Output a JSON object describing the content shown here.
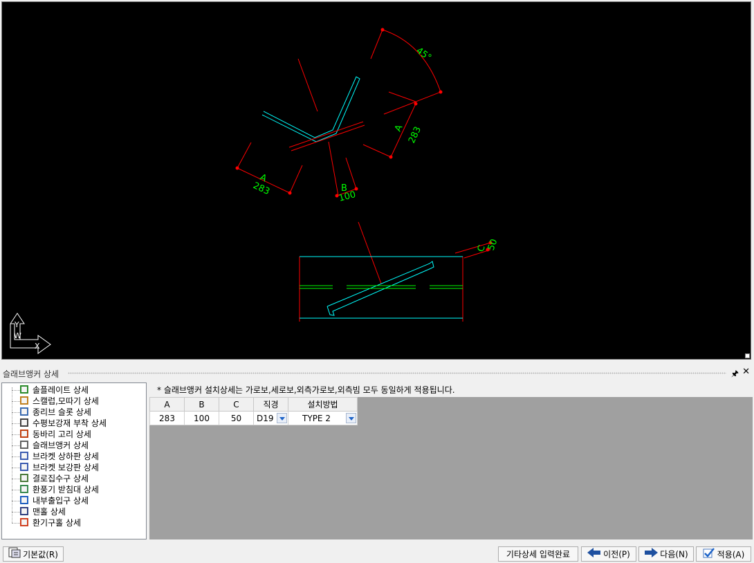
{
  "canvas": {
    "dims": {
      "angle": "45°",
      "dim_a_right": "A",
      "dim_a_right_value": "283",
      "dim_a_left": "A",
      "dim_a_left_value": "283",
      "dim_b": "B",
      "dim_b_value": "100",
      "dim_c": "C",
      "dim_c_value": "50"
    },
    "ucs": {
      "x": "X",
      "y": "Y",
      "w": "W"
    },
    "colors": {
      "background": "#000000",
      "shape": "#00ffff",
      "dimension": "#ff0000",
      "text": "#00ff00"
    }
  },
  "panel": {
    "title": "슬래브앵커 상세",
    "pin_icon": "pin-icon",
    "close_icon": "close-icon"
  },
  "tree": {
    "items": [
      {
        "label": "솔플레이트 상세",
        "icon": "sole-plate-icon"
      },
      {
        "label": "스캘럽,모따기 상세",
        "icon": "scallop-icon"
      },
      {
        "label": "종리브 슬롯 상세",
        "icon": "rib-slot-icon"
      },
      {
        "label": "수평보강재 부착 상세",
        "icon": "stiffener-icon"
      },
      {
        "label": "동바리 고리 상세",
        "icon": "shore-ring-icon"
      },
      {
        "label": "슬래브앵커 상세",
        "icon": "slab-anchor-icon"
      },
      {
        "label": "브라켓 상하판 상세",
        "icon": "bracket-plate-icon"
      },
      {
        "label": "브라켓 보강판 상세",
        "icon": "bracket-stiffener-icon"
      },
      {
        "label": "결로집수구 상세",
        "icon": "drain-icon"
      },
      {
        "label": "환풍기 받침대 상세",
        "icon": "fan-support-icon"
      },
      {
        "label": "내부출입구 상세",
        "icon": "entrance-icon"
      },
      {
        "label": "맨홀 상세",
        "icon": "manhole-icon"
      },
      {
        "label": "환기구홀 상세",
        "icon": "vent-hole-icon"
      }
    ]
  },
  "note": "* 슬래브앵커 설치상세는 가로보,세로보,외측가로보,외측빔 모두 동일하게 적용됩니다.",
  "grid": {
    "headers": [
      "A",
      "B",
      "C",
      "직경",
      "설치방법"
    ],
    "row": [
      "283",
      "100",
      "50",
      "D19",
      "TYPE 2"
    ]
  },
  "buttons": {
    "default": "기본값(R)",
    "complete": "기타상세 입력완료",
    "prev": "이전(P)",
    "next": "다음(N)",
    "apply": "적용(A)"
  }
}
